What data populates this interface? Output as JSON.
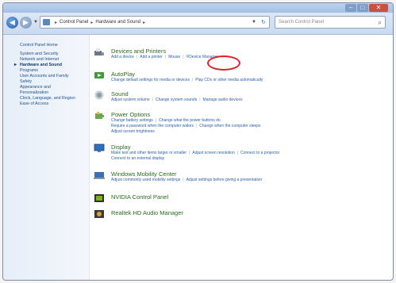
{
  "window": {
    "caption_buttons": {
      "minimize": "–",
      "maximize": "□",
      "close": "✕"
    }
  },
  "navbar": {
    "back_glyph": "◀",
    "forward_glyph": "▶",
    "breadcrumb": [
      "Control Panel",
      "Hardware and Sound"
    ],
    "search_placeholder": "Search Control Panel"
  },
  "sidebar": {
    "items": [
      "Control Panel Home",
      "System and Security",
      "Network and Internet",
      "Hardware and Sound",
      "Programs",
      "User Accounts and Family",
      "Safety",
      "Appearance and",
      "Personalization",
      "Clock, Language, and Region",
      "Ease of Access"
    ]
  },
  "categories": [
    {
      "title": "Devices and Printers",
      "links": [
        "Add a device",
        "Add a printer",
        "Mouse",
        "Device Manager"
      ]
    },
    {
      "title": "AutoPlay",
      "links": [
        "Change default settings for media or devices",
        "Play CDs or other media automatically"
      ]
    },
    {
      "title": "Sound",
      "links": [
        "Adjust system volume",
        "Change system sounds",
        "Manage audio devices"
      ]
    },
    {
      "title": "Power Options",
      "links_row1": [
        "Change battery settings",
        "Change what the power buttons do"
      ],
      "links_row2": [
        "Require a password when the computer wakes",
        "Change when the computer sleeps"
      ],
      "links_row3": [
        "Adjust screen brightness"
      ]
    },
    {
      "title": "Display",
      "links_row1": [
        "Make text and other items larger or smaller",
        "Adjust screen resolution",
        "Connect to a projector"
      ],
      "links_row2": [
        "Connect to an external display"
      ]
    },
    {
      "title": "Windows Mobility Center",
      "links": [
        "Adjust commonly used mobility settings",
        "Adjust settings before giving a presentation"
      ]
    },
    {
      "title": "NVIDIA Control Panel"
    },
    {
      "title": "Realtek HD Audio Manager"
    }
  ],
  "colors": {
    "highlight_ring": "#e0232a",
    "category_title": "#2a6a1e",
    "link": "#2a5fa8"
  }
}
